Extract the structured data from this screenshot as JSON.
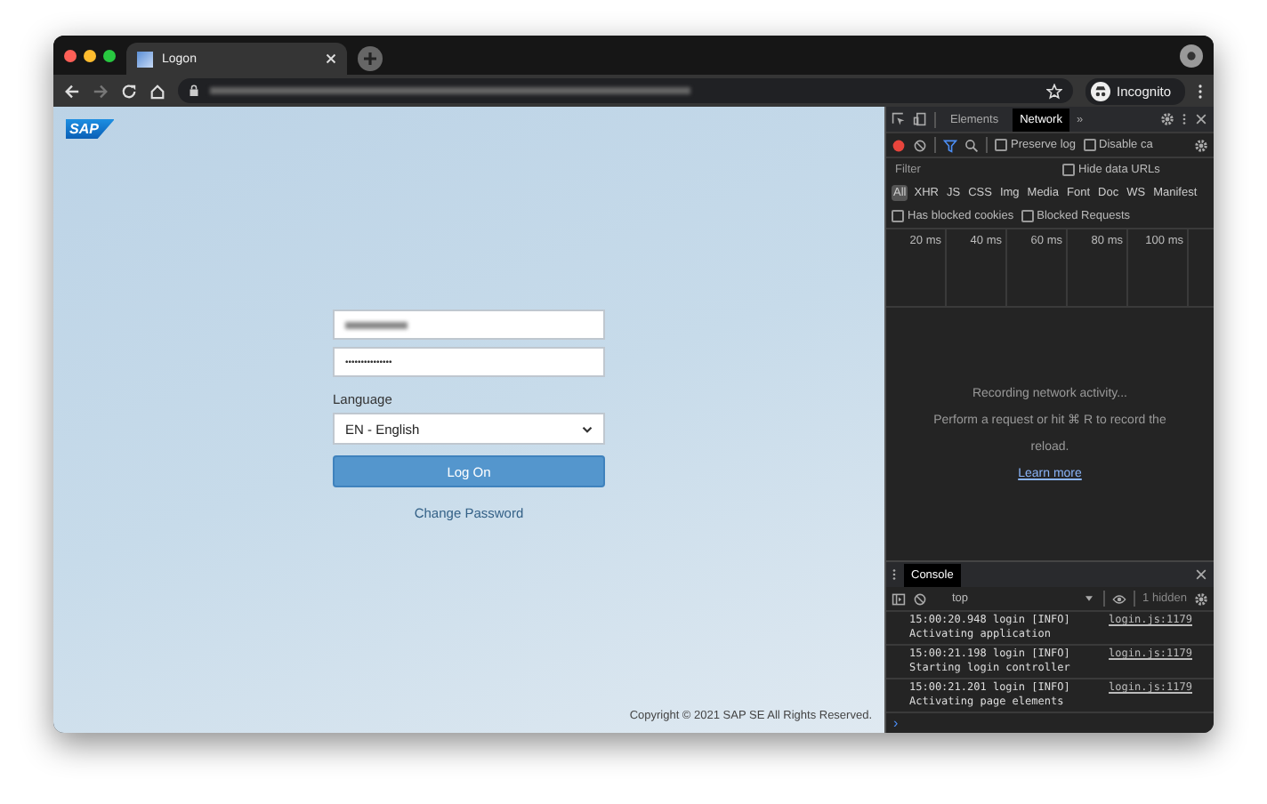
{
  "browser": {
    "tab": {
      "title": "Logon"
    },
    "profile": "Incognito"
  },
  "page": {
    "logo": "SAP",
    "password": "•••••••••••••••",
    "language_label": "Language",
    "language": "EN - English",
    "logon_button": "Log On",
    "change_password": "Change Password",
    "copyright": "Copyright © 2021 SAP SE All Rights Reserved."
  },
  "devtools": {
    "tabs": [
      {
        "label": "Elements",
        "selected": false
      },
      {
        "label": "Network",
        "selected": true
      }
    ],
    "more": "»",
    "options": [
      {
        "label": "Preserve log",
        "checked": false
      },
      {
        "label": "Disable ca",
        "checked": false
      }
    ],
    "filter": {
      "placeholder": "Filter"
    },
    "hide_data_urls": {
      "label": "Hide data URLs",
      "checked": false
    },
    "types": [
      {
        "label": "All",
        "selected": true
      },
      {
        "label": "XHR",
        "selected": false
      },
      {
        "label": "JS",
        "selected": false
      },
      {
        "label": "CSS",
        "selected": false
      },
      {
        "label": "Img",
        "selected": false
      },
      {
        "label": "Media",
        "selected": false
      },
      {
        "label": "Font",
        "selected": false
      },
      {
        "label": "Doc",
        "selected": false
      },
      {
        "label": "WS",
        "selected": false
      },
      {
        "label": "Manifest",
        "selected": false
      }
    ],
    "blocked": [
      {
        "label": "Has blocked cookies",
        "checked": false
      },
      {
        "label": "Blocked Requests",
        "checked": false
      }
    ],
    "timeline_ticks": [
      "20 ms",
      "40 ms",
      "60 ms",
      "80 ms",
      "100 ms"
    ],
    "empty_message": [
      "Recording network activity...",
      "Perform a request or hit ⌘ R to record the reload."
    ],
    "learn_more": "Learn more",
    "drawer_tabs": [
      {
        "label": "Console",
        "selected": true
      }
    ],
    "console": {
      "context": "top",
      "hidden": "1 hidden",
      "prompt": "›",
      "logs": [
        {
          "header": "15:00:20.948 login [INFO]",
          "message": "Activating application",
          "source": "login.js:1179"
        },
        {
          "header": "15:00:21.198 login [INFO]",
          "message": "Starting login controller",
          "source": "login.js:1179"
        },
        {
          "header": "15:00:21.201 login [INFO]",
          "message": "Activating page elements",
          "source": "login.js:1179"
        }
      ]
    }
  }
}
